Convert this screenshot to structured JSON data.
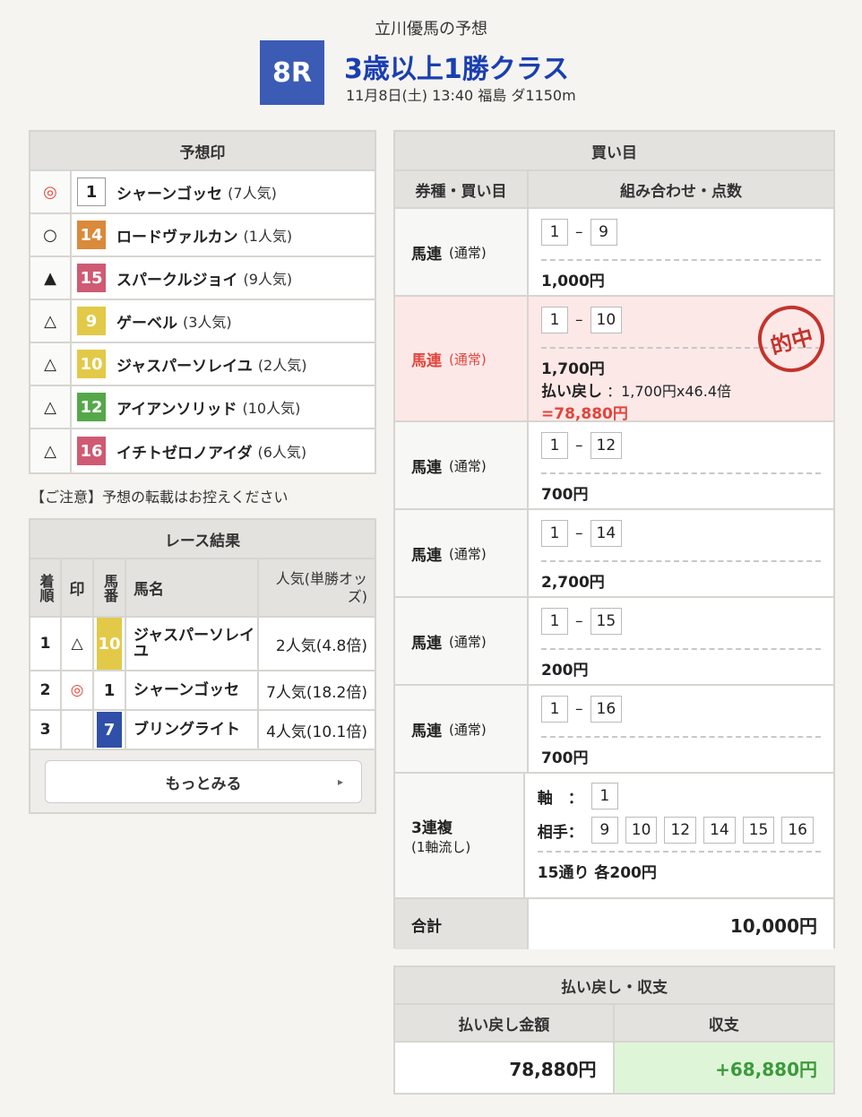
{
  "header": {
    "subtitle": "立川優馬の予想",
    "race_no": "8R",
    "race_title": "3歳以上1勝クラス",
    "race_info": "11月8日(土) 13:40 福島 ダ1150m"
  },
  "prediction": {
    "title": "予想印",
    "rows": [
      {
        "mark": "◎",
        "num": "1",
        "name": "シャーンゴッセ",
        "pop": "(7人気)"
      },
      {
        "mark": "○",
        "num": "14",
        "name": "ロードヴァルカン",
        "pop": "(1人気)"
      },
      {
        "mark": "▲",
        "num": "15",
        "name": "スパークルジョイ",
        "pop": "(9人気)"
      },
      {
        "mark": "△",
        "num": "9",
        "name": "ゲーベル",
        "pop": "(3人気)"
      },
      {
        "mark": "△",
        "num": "10",
        "name": "ジャスパーソレイユ",
        "pop": "(2人気)"
      },
      {
        "mark": "△",
        "num": "12",
        "name": "アイアンソリッド",
        "pop": "(10人気)"
      },
      {
        "mark": "△",
        "num": "16",
        "name": "イチトゼロノアイダ",
        "pop": "(6人気)"
      }
    ]
  },
  "note": "【ご注意】予想の転載はお控えください",
  "results": {
    "title": "レース結果",
    "headers": {
      "rank": "着順",
      "mark": "印",
      "num": "馬番",
      "name": "馬名",
      "pop": "人気(単勝オッズ)"
    },
    "rows": [
      {
        "rank": "1",
        "mark": "△",
        "num": "10",
        "name": "ジャスパーソレイユ",
        "pop": "2人気(4.8倍)"
      },
      {
        "rank": "2",
        "mark": "◎",
        "num": "1",
        "name": "シャーンゴッセ",
        "pop": "7人気(18.2倍)"
      },
      {
        "rank": "3",
        "mark": "",
        "num": "7",
        "name": "ブリングライト",
        "pop": "4人気(10.1倍)"
      }
    ],
    "more": "もっとみる",
    "more_chevron": "▸"
  },
  "bets": {
    "title": "買い目",
    "col1": "券種・買い目",
    "col2": "組み合わせ・点数",
    "rows": [
      {
        "type": "馬連",
        "sub": "(通常)",
        "a": "1",
        "dash": "–",
        "b": "9",
        "amount": "1,000円"
      },
      {
        "type": "馬連",
        "sub": "(通常)",
        "a": "1",
        "dash": "–",
        "b": "10",
        "amount": "1,700円",
        "payback_label": "払い戻し",
        "payback_calc": "：1,700円x46.4倍",
        "payback_total": "=78,880円",
        "stamp": "的中"
      },
      {
        "type": "馬連",
        "sub": "(通常)",
        "a": "1",
        "dash": "–",
        "b": "12",
        "amount": "700円"
      },
      {
        "type": "馬連",
        "sub": "(通常)",
        "a": "1",
        "dash": "–",
        "b": "14",
        "amount": "2,700円"
      },
      {
        "type": "馬連",
        "sub": "(通常)",
        "a": "1",
        "dash": "–",
        "b": "15",
        "amount": "200円"
      },
      {
        "type": "馬連",
        "sub": "(通常)",
        "a": "1",
        "dash": "–",
        "b": "16",
        "amount": "700円"
      }
    ],
    "sanrenpuku": {
      "type": "3連複",
      "sub": "(1軸流し)",
      "axis_label": "軸　：",
      "axis": "1",
      "partner_label": "相手：",
      "partners": [
        "9",
        "10",
        "12",
        "14",
        "15",
        "16"
      ],
      "summary": "15通り 各200円"
    },
    "total_label": "合計",
    "total": "10,000円"
  },
  "payout": {
    "title": "払い戻し・収支",
    "col1": "払い戻し金額",
    "col2": "収支",
    "amount": "78,880円",
    "profit": "+68,880円"
  }
}
